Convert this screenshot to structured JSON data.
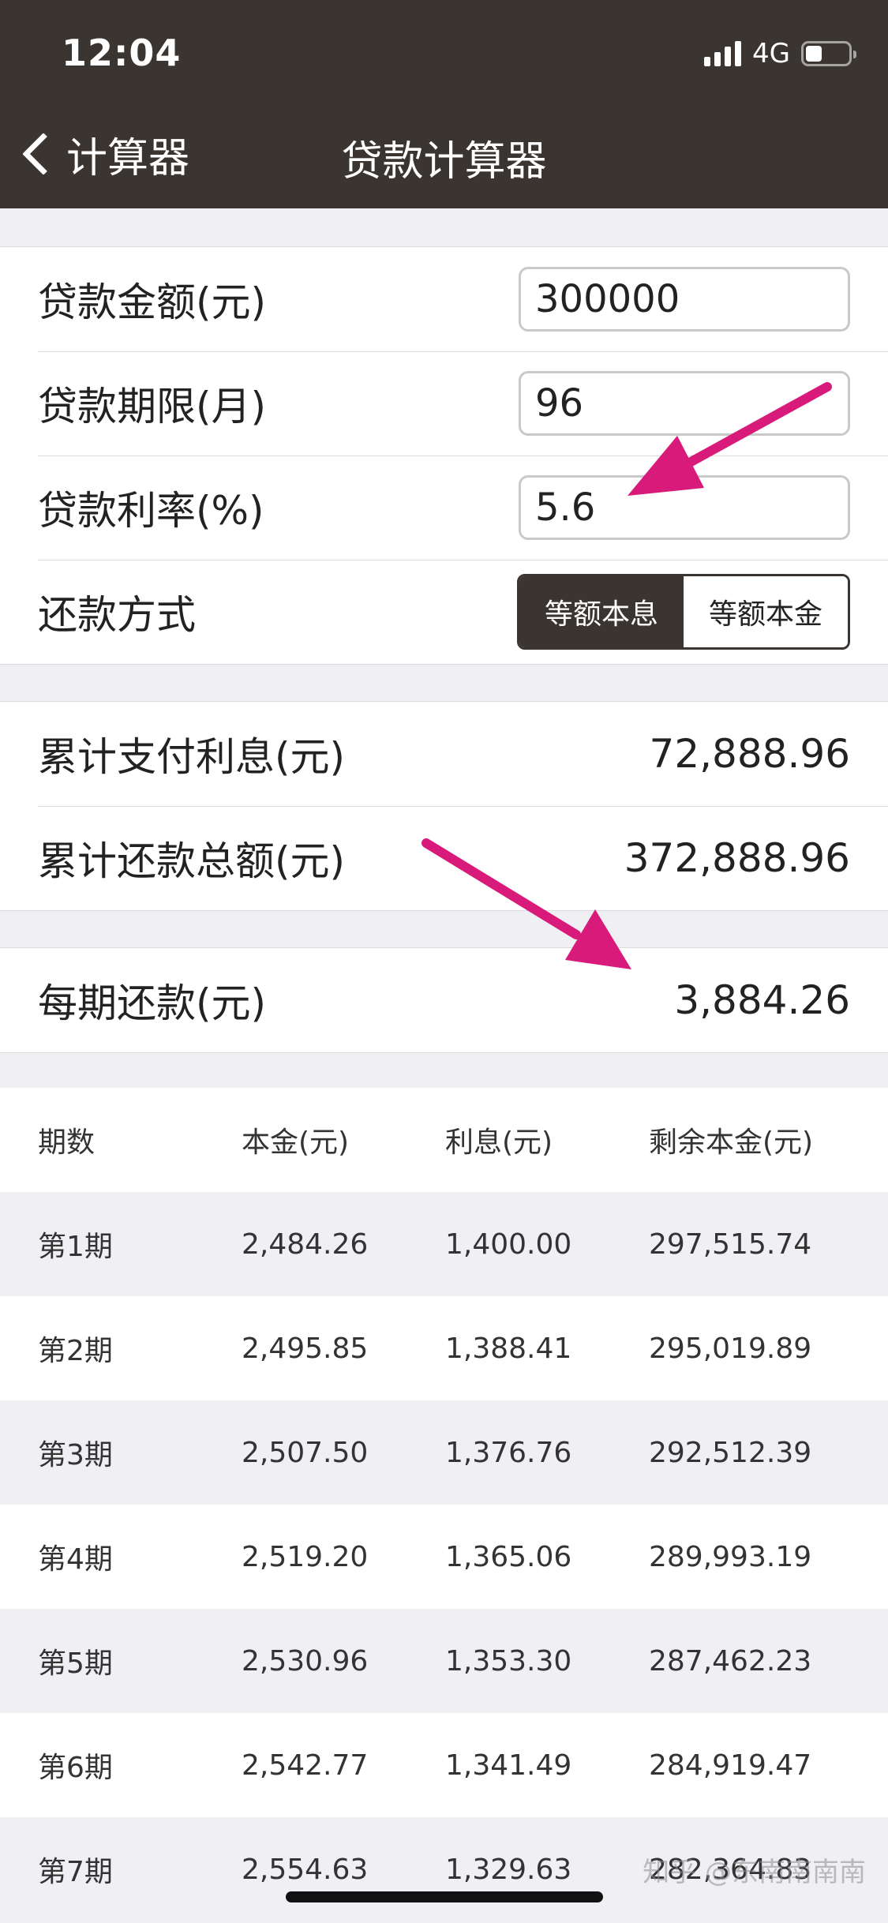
{
  "status_bar": {
    "time": "12:04",
    "network": "4G"
  },
  "nav": {
    "back_label": "计算器",
    "title": "贷款计算器"
  },
  "inputs": [
    {
      "label": "贷款金额(元)",
      "value": "300000"
    },
    {
      "label": "贷款期限(月)",
      "value": "96"
    },
    {
      "label": "贷款利率(%)",
      "value": "5.6"
    }
  ],
  "repayment": {
    "label": "还款方式",
    "options": [
      "等额本息",
      "等额本金"
    ],
    "selected": "等额本息"
  },
  "summary": [
    {
      "label": "累计支付利息(元)",
      "value": "72,888.96"
    },
    {
      "label": "累计还款总额(元)",
      "value": "372,888.96"
    }
  ],
  "monthly": {
    "label": "每期还款(元)",
    "value": "3,884.26"
  },
  "table": {
    "headers": [
      "期数",
      "本金(元)",
      "利息(元)",
      "剩余本金(元)"
    ],
    "rows": [
      [
        "第1期",
        "2,484.26",
        "1,400.00",
        "297,515.74"
      ],
      [
        "第2期",
        "2,495.85",
        "1,388.41",
        "295,019.89"
      ],
      [
        "第3期",
        "2,507.50",
        "1,376.76",
        "292,512.39"
      ],
      [
        "第4期",
        "2,519.20",
        "1,365.06",
        "289,993.19"
      ],
      [
        "第5期",
        "2,530.96",
        "1,353.30",
        "287,462.23"
      ],
      [
        "第6期",
        "2,542.77",
        "1,341.49",
        "284,919.47"
      ],
      [
        "第7期",
        "2,554.63",
        "1,329.63",
        "282,364.83"
      ]
    ]
  },
  "annotation_color": "#d81b7a",
  "watermark": "知乎 @东南南南南"
}
